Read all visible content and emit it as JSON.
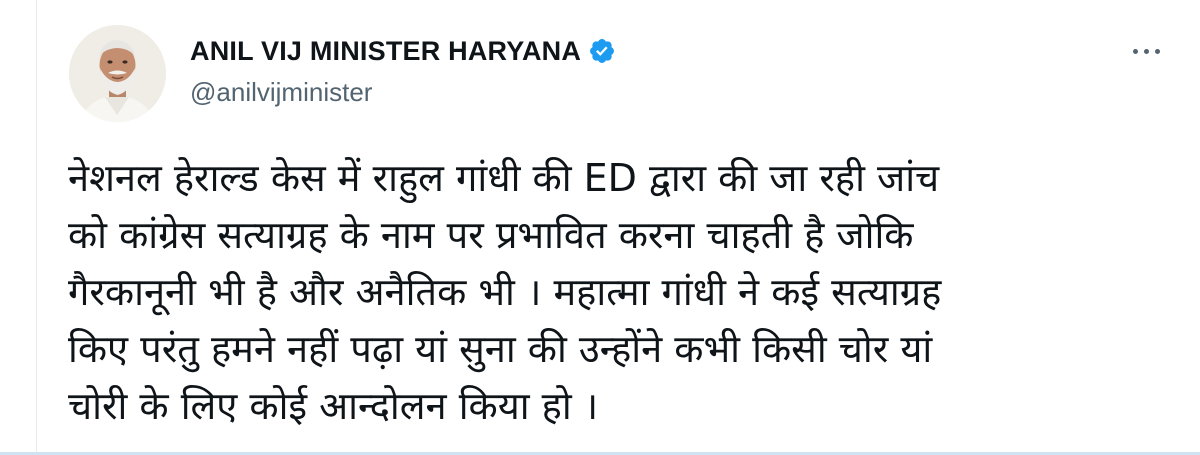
{
  "author": {
    "display_name": "ANIL VIJ MINISTER HARYANA",
    "handle": "@anilvijminister",
    "verified": true,
    "verified_color": "#1d9bf0"
  },
  "avatar": {
    "icon": "profile-photo"
  },
  "menu": {
    "icon": "more-horizontal-icon"
  },
  "tweet": {
    "lines": [
      "नेशनल हेराल्ड केस में राहुल गांधी की ED द्वारा की जा रही जांच",
      "को कांग्रेस सत्याग्रह के नाम पर प्रभावित करना चाहती है जोकि",
      "गैरकानूनी भी है और अनैतिक भी । महात्मा गांधी ने कई सत्याग्रह",
      "किए परंतु हमने नहीं पढ़ा यां सुना की उन्होंने कभी किसी चोर यां",
      "चोरी के लिए कोई आन्दोलन किया हो ।"
    ]
  },
  "colors": {
    "text": "#0f1419",
    "secondary": "#536471",
    "accent": "#1d9bf0"
  }
}
